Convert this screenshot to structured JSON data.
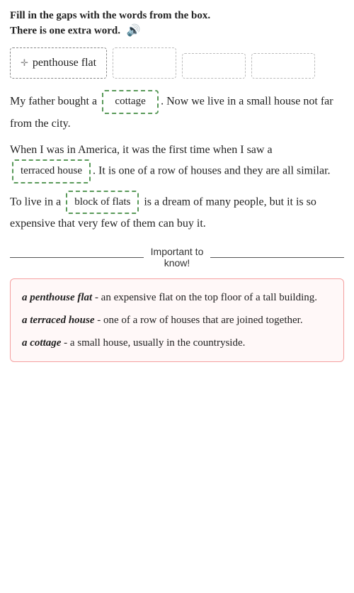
{
  "instruction": {
    "line1": "Fill in the gaps with the words from the box.",
    "line2": "There is one extra word."
  },
  "word_bank": {
    "filled_word": "penthouse flat",
    "empty_boxes": 3
  },
  "paragraphs": [
    {
      "id": "p1",
      "parts": [
        "My father bought a ",
        "cottage",
        ". Now we live in a small house not far from the city."
      ]
    },
    {
      "id": "p2",
      "parts": [
        "When I was in America, it was the first time when I saw a ",
        "terraced house",
        ". It is one of a row of houses and they are all similar."
      ]
    },
    {
      "id": "p3",
      "parts": [
        "To live in a ",
        "block of flats",
        " is a dream of many people, but it is so expensive that very few of them can buy it."
      ]
    }
  ],
  "important": {
    "label_line1": "Important to",
    "label_line2": "know!"
  },
  "definitions": [
    {
      "term": "a penthouse flat",
      "definition": " - an expensive flat on the top floor of a tall building."
    },
    {
      "term": "a terraced house",
      "definition": " - one of a row of houses that are joined together."
    },
    {
      "term": "a cottage",
      "definition": " - a small house, usually in the countryside."
    }
  ]
}
